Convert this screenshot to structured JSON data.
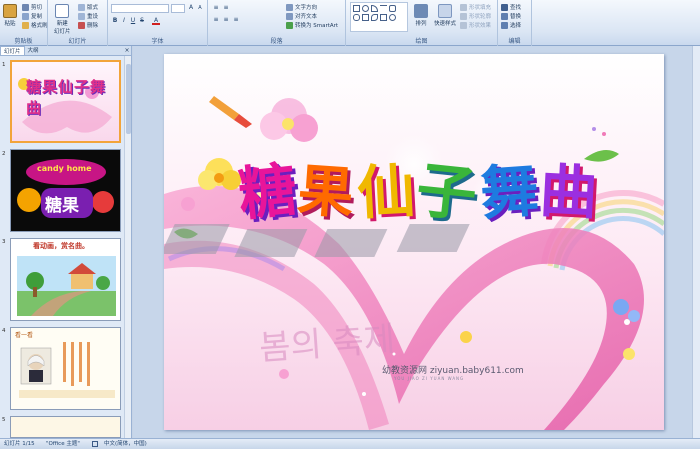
{
  "ribbon": {
    "clipboard": {
      "paste": "粘贴",
      "cut": "剪切",
      "copy": "复制",
      "format_painter": "格式刷",
      "label": "剪贴板"
    },
    "slides": {
      "new_slide": "新建\n幻灯片",
      "layout": "版式",
      "reset": "重设",
      "delete": "删除",
      "label": "幻灯片"
    },
    "font": {
      "label": "字体"
    },
    "paragraph": {
      "text_direction": "文字方向",
      "align_text": "对齐文本",
      "smartart": "转换为 SmartArt",
      "label": "段落"
    },
    "drawing": {
      "arrange": "排列",
      "quick_styles": "快速样式",
      "shape_fill": "形状填充",
      "shape_outline": "形状轮廓",
      "shape_effects": "形状效果",
      "label": "绘图"
    },
    "editing": {
      "find": "查找",
      "replace": "替换",
      "select": "选择",
      "label": "编辑"
    }
  },
  "pane": {
    "tabs": [
      "幻灯片",
      "大纲"
    ],
    "close": "×",
    "thumbs": [
      {
        "num": "1",
        "title": "糖果仙子舞曲"
      },
      {
        "num": "2",
        "banner": "candy home",
        "title": "糖果"
      },
      {
        "num": "3",
        "title": "看动画，赏名曲。"
      },
      {
        "num": "4",
        "title": "看一看"
      },
      {
        "num": "5"
      }
    ]
  },
  "slide": {
    "title": "糖果仙子舞曲",
    "korean": "봄의 축제",
    "watermark": "幼教资源网 ziyuan.baby611.com",
    "watermark_sub": "YOU JIAO ZI YUAN WANG"
  },
  "status": {
    "slide_of": "幻灯片 1/15",
    "theme": "\"Office 主题\"",
    "language": "中文(简体，中国)"
  }
}
